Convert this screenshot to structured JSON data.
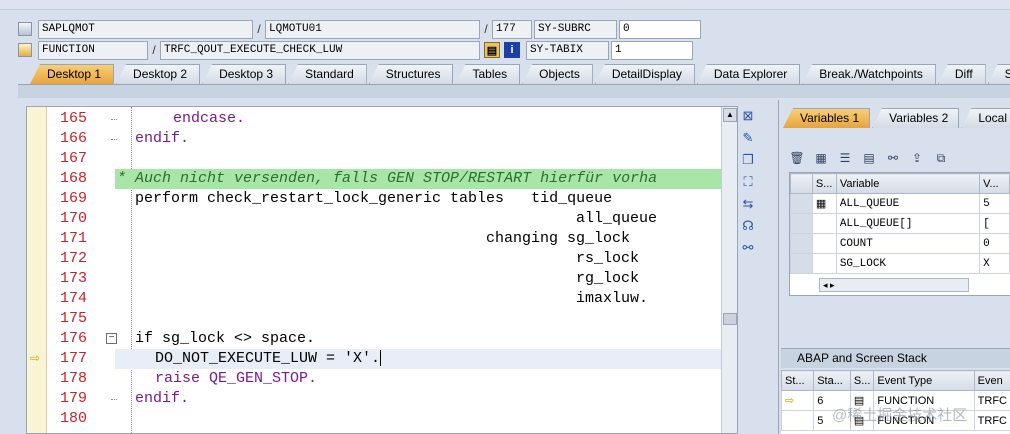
{
  "header": {
    "row1": {
      "program": "SAPLQMOT",
      "include": "LQMOTU01",
      "line": "177",
      "sysfield": "SY-SUBRC",
      "sysvalue": "0"
    },
    "row2": {
      "type": "FUNCTION",
      "name": "TRFC_QOUT_EXECUTE_CHECK_LUW",
      "sysfield": "SY-TABIX",
      "sysvalue": "1"
    }
  },
  "tabs": [
    "Desktop 1",
    "Desktop 2",
    "Desktop 3",
    "Standard",
    "Structures",
    "Tables",
    "Objects",
    "DetailDisplay",
    "Data Explorer",
    "Break./Watchpoints",
    "Diff",
    "Script"
  ],
  "code": {
    "lines": [
      {
        "num": "165",
        "text": "  endcase."
      },
      {
        "num": "166",
        "text": "endif."
      },
      {
        "num": "167",
        "text": ""
      },
      {
        "num": "168",
        "text": "* Auch nicht versenden, falls GEN STOP/RESTART hierfür vorha"
      },
      {
        "num": "169",
        "text": "perform check_restart_lock_generic tables   tid_queue"
      },
      {
        "num": "170",
        "text": "all_queue"
      },
      {
        "num": "171",
        "text": "changing sg_lock"
      },
      {
        "num": "172",
        "text": "rs_lock"
      },
      {
        "num": "173",
        "text": "rg_lock"
      },
      {
        "num": "174",
        "text": "imaxluw."
      },
      {
        "num": "175",
        "text": ""
      },
      {
        "num": "176",
        "text": "if sg_lock <> space."
      },
      {
        "num": "177",
        "text": "DO_NOT_EXECUTE_LUW = 'X'."
      },
      {
        "num": "178",
        "text": "raise QE_GEN_STOP."
      },
      {
        "num": "179",
        "text": "endif."
      },
      {
        "num": "180",
        "text": ""
      }
    ]
  },
  "right_panel": {
    "tabs": [
      "Variables 1",
      "Variables 2",
      "Local"
    ],
    "grid": {
      "columns": [
        "S...",
        "Variable",
        "V..."
      ],
      "rows": [
        {
          "variable": "ALL_QUEUE",
          "value": "5"
        },
        {
          "variable": "ALL_QUEUE[]",
          "value": "["
        },
        {
          "variable": "COUNT",
          "value": "0"
        },
        {
          "variable": "SG_LOCK",
          "value": "X"
        }
      ]
    },
    "stack": {
      "title": "ABAP and Screen Stack",
      "columns": [
        "St...",
        "Sta...",
        "S...",
        "Event Type",
        "Even"
      ],
      "rows": [
        {
          "level": "6",
          "type": "FUNCTION",
          "event": "TRFC"
        },
        {
          "level": "5",
          "type": "FUNCTION",
          "event": "TRFC"
        }
      ]
    }
  },
  "watermark": "@稀土掘金技术社区"
}
